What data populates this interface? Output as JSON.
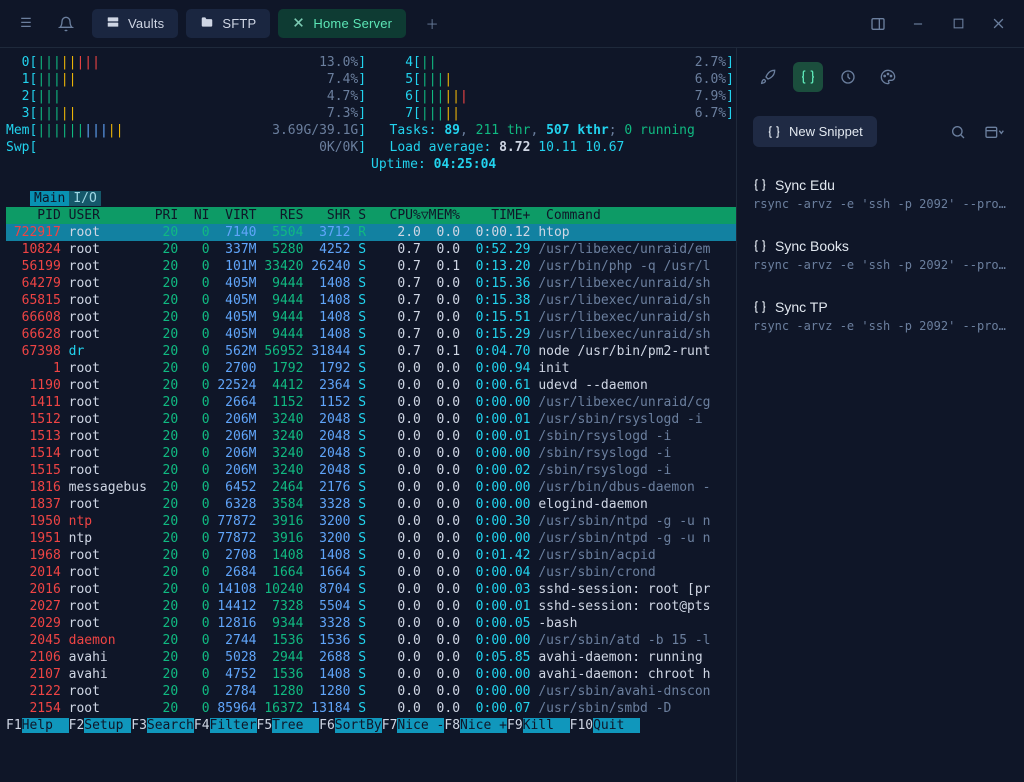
{
  "window": {
    "tabs": [
      {
        "icon": "server-icon",
        "label": "Vaults",
        "active": false
      },
      {
        "icon": "folder-icon",
        "label": "SFTP",
        "active": false
      },
      {
        "icon": "close-icon",
        "label": "Home Server",
        "active": true
      }
    ],
    "controls": [
      "panel-toggle-icon",
      "minimize-icon",
      "maximize-icon",
      "close-window-icon"
    ]
  },
  "cpus": {
    "cols": [
      [
        {
          "idx": "0",
          "bars": "||||||||",
          "pct": "13.0%"
        },
        {
          "idx": "1",
          "bars": "|||||",
          "pct": "7.4%"
        },
        {
          "idx": "2",
          "bars": "|||",
          "pct": "4.7%"
        },
        {
          "idx": "3",
          "bars": "|||||",
          "pct": "7.3%"
        }
      ],
      [
        {
          "idx": "4",
          "bars": "||",
          "pct": "2.7%"
        },
        {
          "idx": "5",
          "bars": "||||",
          "pct": "6.0%"
        },
        {
          "idx": "6",
          "bars": "||||||",
          "pct": "7.9%"
        },
        {
          "idx": "7",
          "bars": "|||||",
          "pct": "6.7%"
        }
      ]
    ]
  },
  "mem": {
    "label": "Mem",
    "bars": "|||||||||||",
    "value": "3.69G/39.1G"
  },
  "swp": {
    "label": "Swp",
    "bars": "",
    "value": "0K/0K"
  },
  "tasks_line": {
    "t_label": "Tasks:",
    "tasks": "89",
    "thr": "211 thr",
    "kthr": "507 kthr",
    "run": "0 running"
  },
  "loadavg": {
    "label": "Load average:",
    "v1": "8.72",
    "v2": "10.11",
    "v3": "10.67"
  },
  "uptime": {
    "label": "Uptime:",
    "value": "04:25:04"
  },
  "subtabs": {
    "left": "Main",
    "right": "I/O"
  },
  "columns": "    PID USER       PRI  NI  VIRT   RES   SHR S   CPU%▽MEM%    TIME+  Command",
  "fnkeys": [
    {
      "key": "F1",
      "label": "Help  "
    },
    {
      "key": "F2",
      "label": "Setup "
    },
    {
      "key": "F3",
      "label": "Search"
    },
    {
      "key": "F4",
      "label": "Filter"
    },
    {
      "key": "F5",
      "label": "Tree  "
    },
    {
      "key": "F6",
      "label": "SortBy"
    },
    {
      "key": "F7",
      "label": "Nice -"
    },
    {
      "key": "F8",
      "label": "Nice +"
    },
    {
      "key": "F9",
      "label": "Kill  "
    },
    {
      "key": "F10",
      "label": "Quit  "
    }
  ],
  "rows": [
    {
      "pid": "722917",
      "user": "root",
      "uc": "wh",
      "pri": "20",
      "ni": "0",
      "virt": "7140",
      "res": "5504",
      "shr": "3712",
      "s": "R",
      "sc": "gr",
      "cpu": "2.0",
      "mem": "0.0",
      "time": "0:00.12",
      "tc": "wh",
      "cmd": "htop",
      "cc": "wh",
      "sel": true
    },
    {
      "pid": "10824",
      "user": "root",
      "uc": "wh",
      "pri": "20",
      "ni": "0",
      "virt": "337M",
      "res": "5280",
      "shr": "4252",
      "s": "S",
      "sc": "cy",
      "cpu": "0.7",
      "mem": "0.0",
      "time": "0:52.29",
      "tc": "cy",
      "cmd": "/usr/libexec/unraid/em",
      "cc": "gy"
    },
    {
      "pid": "56199",
      "user": "root",
      "uc": "wh",
      "pri": "20",
      "ni": "0",
      "virt": "101M",
      "res": "33420",
      "shr": "26240",
      "s": "S",
      "sc": "cy",
      "cpu": "0.7",
      "mem": "0.1",
      "time": "0:13.20",
      "tc": "cy",
      "cmd": "/usr/bin/php -q /usr/l",
      "cc": "gy"
    },
    {
      "pid": "64279",
      "user": "root",
      "uc": "wh",
      "pri": "20",
      "ni": "0",
      "virt": "405M",
      "res": "9444",
      "shr": "1408",
      "s": "S",
      "sc": "cy",
      "cpu": "0.7",
      "mem": "0.0",
      "time": "0:15.36",
      "tc": "cy",
      "cmd": "/usr/libexec/unraid/sh",
      "cc": "gy"
    },
    {
      "pid": "65815",
      "user": "root",
      "uc": "wh",
      "pri": "20",
      "ni": "0",
      "virt": "405M",
      "res": "9444",
      "shr": "1408",
      "s": "S",
      "sc": "cy",
      "cpu": "0.7",
      "mem": "0.0",
      "time": "0:15.38",
      "tc": "cy",
      "cmd": "/usr/libexec/unraid/sh",
      "cc": "gy"
    },
    {
      "pid": "66608",
      "user": "root",
      "uc": "wh",
      "pri": "20",
      "ni": "0",
      "virt": "405M",
      "res": "9444",
      "shr": "1408",
      "s": "S",
      "sc": "cy",
      "cpu": "0.7",
      "mem": "0.0",
      "time": "0:15.51",
      "tc": "cy",
      "cmd": "/usr/libexec/unraid/sh",
      "cc": "gy"
    },
    {
      "pid": "66628",
      "user": "root",
      "uc": "wh",
      "pri": "20",
      "ni": "0",
      "virt": "405M",
      "res": "9444",
      "shr": "1408",
      "s": "S",
      "sc": "cy",
      "cpu": "0.7",
      "mem": "0.0",
      "time": "0:15.29",
      "tc": "cy",
      "cmd": "/usr/libexec/unraid/sh",
      "cc": "gy"
    },
    {
      "pid": "67398",
      "user": "dr",
      "uc": "cy",
      "pri": "20",
      "ni": "0",
      "virt": "562M",
      "res": "56952",
      "shr": "31844",
      "s": "S",
      "sc": "cy",
      "cpu": "0.7",
      "mem": "0.1",
      "time": "0:04.70",
      "tc": "cy",
      "cmd": "node /usr/bin/pm2-runt",
      "cc": "wh"
    },
    {
      "pid": "1",
      "user": "root",
      "uc": "wh",
      "pri": "20",
      "ni": "0",
      "virt": "2700",
      "res": "1792",
      "shr": "1792",
      "s": "S",
      "sc": "cy",
      "cpu": "0.0",
      "mem": "0.0",
      "time": "0:00.94",
      "tc": "cy",
      "cmd": "init",
      "cc": "wh"
    },
    {
      "pid": "1190",
      "user": "root",
      "uc": "wh",
      "pri": "20",
      "ni": "0",
      "virt": "22524",
      "res": "4412",
      "shr": "2364",
      "s": "S",
      "sc": "cy",
      "cpu": "0.0",
      "mem": "0.0",
      "time": "0:00.61",
      "tc": "cy",
      "cmd": "udevd --daemon",
      "cc": "wh"
    },
    {
      "pid": "1411",
      "user": "root",
      "uc": "wh",
      "pri": "20",
      "ni": "0",
      "virt": "2664",
      "res": "1152",
      "shr": "1152",
      "s": "S",
      "sc": "cy",
      "cpu": "0.0",
      "mem": "0.0",
      "time": "0:00.00",
      "tc": "cy",
      "cmd": "/usr/libexec/unraid/cg",
      "cc": "gy"
    },
    {
      "pid": "1512",
      "user": "root",
      "uc": "wh",
      "pri": "20",
      "ni": "0",
      "virt": "206M",
      "res": "3240",
      "shr": "2048",
      "s": "S",
      "sc": "cy",
      "cpu": "0.0",
      "mem": "0.0",
      "time": "0:00.01",
      "tc": "cy",
      "cmd": "/usr/sbin/rsyslogd -i",
      "cc": "gy"
    },
    {
      "pid": "1513",
      "user": "root",
      "uc": "wh",
      "pri": "20",
      "ni": "0",
      "virt": "206M",
      "res": "3240",
      "shr": "2048",
      "s": "S",
      "sc": "cy",
      "cpu": "0.0",
      "mem": "0.0",
      "time": "0:00.01",
      "tc": "cy",
      "cmd": "/sbin/rsyslogd -i",
      "cc": "gy"
    },
    {
      "pid": "1514",
      "user": "root",
      "uc": "wh",
      "pri": "20",
      "ni": "0",
      "virt": "206M",
      "res": "3240",
      "shr": "2048",
      "s": "S",
      "sc": "cy",
      "cpu": "0.0",
      "mem": "0.0",
      "time": "0:00.00",
      "tc": "cy",
      "cmd": "/sbin/rsyslogd -i",
      "cc": "gy"
    },
    {
      "pid": "1515",
      "user": "root",
      "uc": "wh",
      "pri": "20",
      "ni": "0",
      "virt": "206M",
      "res": "3240",
      "shr": "2048",
      "s": "S",
      "sc": "cy",
      "cpu": "0.0",
      "mem": "0.0",
      "time": "0:00.02",
      "tc": "cy",
      "cmd": "/sbin/rsyslogd -i",
      "cc": "gy"
    },
    {
      "pid": "1816",
      "user": "messagebus",
      "uc": "wh",
      "pri": "20",
      "ni": "0",
      "virt": "6452",
      "res": "2464",
      "shr": "2176",
      "s": "S",
      "sc": "cy",
      "cpu": "0.0",
      "mem": "0.0",
      "time": "0:00.00",
      "tc": "cy",
      "cmd": "/usr/bin/dbus-daemon -",
      "cc": "gy"
    },
    {
      "pid": "1837",
      "user": "root",
      "uc": "wh",
      "pri": "20",
      "ni": "0",
      "virt": "6328",
      "res": "3584",
      "shr": "3328",
      "s": "S",
      "sc": "cy",
      "cpu": "0.0",
      "mem": "0.0",
      "time": "0:00.00",
      "tc": "cy",
      "cmd": "elogind-daemon",
      "cc": "wh"
    },
    {
      "pid": "1950",
      "user": "ntp",
      "uc": "re",
      "pri": "20",
      "ni": "0",
      "virt": "77872",
      "res": "3916",
      "shr": "3200",
      "s": "S",
      "sc": "cy",
      "cpu": "0.0",
      "mem": "0.0",
      "time": "0:00.30",
      "tc": "cy",
      "cmd": "/usr/sbin/ntpd -g -u n",
      "cc": "gy"
    },
    {
      "pid": "1951",
      "user": "ntp",
      "uc": "wh",
      "pri": "20",
      "ni": "0",
      "virt": "77872",
      "res": "3916",
      "shr": "3200",
      "s": "S",
      "sc": "cy",
      "cpu": "0.0",
      "mem": "0.0",
      "time": "0:00.00",
      "tc": "cy",
      "cmd": "/usr/sbin/ntpd -g -u n",
      "cc": "gy"
    },
    {
      "pid": "1968",
      "user": "root",
      "uc": "wh",
      "pri": "20",
      "ni": "0",
      "virt": "2708",
      "res": "1408",
      "shr": "1408",
      "s": "S",
      "sc": "cy",
      "cpu": "0.0",
      "mem": "0.0",
      "time": "0:01.42",
      "tc": "cy",
      "cmd": "/usr/sbin/acpid",
      "cc": "gy"
    },
    {
      "pid": "2014",
      "user": "root",
      "uc": "wh",
      "pri": "20",
      "ni": "0",
      "virt": "2684",
      "res": "1664",
      "shr": "1664",
      "s": "S",
      "sc": "cy",
      "cpu": "0.0",
      "mem": "0.0",
      "time": "0:00.04",
      "tc": "cy",
      "cmd": "/usr/sbin/crond",
      "cc": "gy"
    },
    {
      "pid": "2016",
      "user": "root",
      "uc": "wh",
      "pri": "20",
      "ni": "0",
      "virt": "14108",
      "res": "10240",
      "shr": "8704",
      "s": "S",
      "sc": "cy",
      "cpu": "0.0",
      "mem": "0.0",
      "time": "0:00.03",
      "tc": "cy",
      "cmd": "sshd-session: root [pr",
      "cc": "wh"
    },
    {
      "pid": "2027",
      "user": "root",
      "uc": "wh",
      "pri": "20",
      "ni": "0",
      "virt": "14412",
      "res": "7328",
      "shr": "5504",
      "s": "S",
      "sc": "cy",
      "cpu": "0.0",
      "mem": "0.0",
      "time": "0:00.01",
      "tc": "cy",
      "cmd": "sshd-session: root@pts",
      "cc": "wh"
    },
    {
      "pid": "2029",
      "user": "root",
      "uc": "wh",
      "pri": "20",
      "ni": "0",
      "virt": "12816",
      "res": "9344",
      "shr": "3328",
      "s": "S",
      "sc": "cy",
      "cpu": "0.0",
      "mem": "0.0",
      "time": "0:00.05",
      "tc": "cy",
      "cmd": "-bash",
      "cc": "wh"
    },
    {
      "pid": "2045",
      "user": "daemon",
      "uc": "re",
      "pri": "20",
      "ni": "0",
      "virt": "2744",
      "res": "1536",
      "shr": "1536",
      "s": "S",
      "sc": "cy",
      "cpu": "0.0",
      "mem": "0.0",
      "time": "0:00.00",
      "tc": "cy",
      "cmd": "/usr/sbin/atd -b 15 -l",
      "cc": "gy"
    },
    {
      "pid": "2106",
      "user": "avahi",
      "uc": "wh",
      "pri": "20",
      "ni": "0",
      "virt": "5028",
      "res": "2944",
      "shr": "2688",
      "s": "S",
      "sc": "cy",
      "cpu": "0.0",
      "mem": "0.0",
      "time": "0:05.85",
      "tc": "cy",
      "cmd": "avahi-daemon: running",
      "cc": "wh"
    },
    {
      "pid": "2107",
      "user": "avahi",
      "uc": "wh",
      "pri": "20",
      "ni": "0",
      "virt": "4752",
      "res": "1536",
      "shr": "1408",
      "s": "S",
      "sc": "cy",
      "cpu": "0.0",
      "mem": "0.0",
      "time": "0:00.00",
      "tc": "cy",
      "cmd": "avahi-daemon: chroot h",
      "cc": "wh"
    },
    {
      "pid": "2122",
      "user": "root",
      "uc": "wh",
      "pri": "20",
      "ni": "0",
      "virt": "2784",
      "res": "1280",
      "shr": "1280",
      "s": "S",
      "sc": "cy",
      "cpu": "0.0",
      "mem": "0.0",
      "time": "0:00.00",
      "tc": "cy",
      "cmd": "/usr/sbin/avahi-dnscon",
      "cc": "gy"
    },
    {
      "pid": "2154",
      "user": "root",
      "uc": "wh",
      "pri": "20",
      "ni": "0",
      "virt": "85964",
      "res": "16372",
      "shr": "13184",
      "s": "S",
      "sc": "cy",
      "cpu": "0.0",
      "mem": "0.0",
      "time": "0:00.07",
      "tc": "cy",
      "cmd": "/usr/sbin/smbd -D",
      "cc": "gy"
    }
  ],
  "side": {
    "new_snippet": "New Snippet",
    "snippets": [
      {
        "title": "Sync Edu",
        "cmd": "rsync -arvz -e 'ssh -p 2092' --pro…"
      },
      {
        "title": "Sync Books",
        "cmd": "rsync -arvz -e 'ssh -p 2092' --pro…"
      },
      {
        "title": "Sync TP",
        "cmd": "rsync -arvz -e 'ssh -p 2092' --pro…"
      }
    ]
  }
}
